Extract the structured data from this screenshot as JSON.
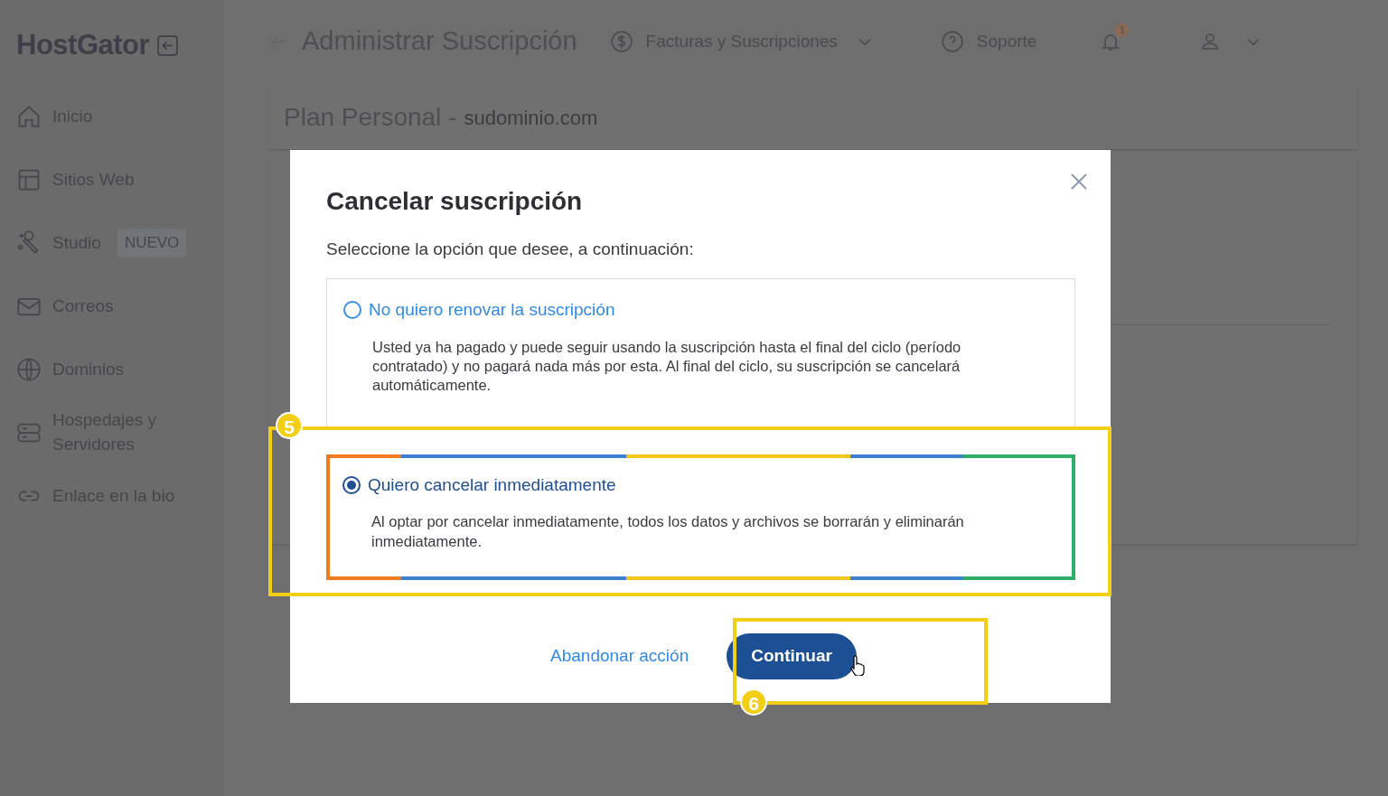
{
  "sidebar": {
    "logo": "HostGator",
    "items": [
      {
        "kind": "home",
        "label": "Inicio"
      },
      {
        "kind": "layout",
        "label": "Sitios Web"
      },
      {
        "kind": "wand",
        "label": "Studio",
        "badge": "NUEVO"
      },
      {
        "kind": "mail",
        "label": "Correos"
      },
      {
        "kind": "globe",
        "label": "Dominios"
      },
      {
        "kind": "server",
        "label": "Hospedajes y Servidores"
      },
      {
        "kind": "link",
        "label": "Enlace en la bio"
      }
    ]
  },
  "header": {
    "title": "Administrar Suscripción",
    "menu": "Facturas y Suscripciones",
    "support": "Soporte",
    "notifications": "1"
  },
  "plan": {
    "name": "Plan Personal - ",
    "domain": "sudominio.com"
  },
  "modal": {
    "title": "Cancelar suscripción",
    "subtitle": "Seleccione la opción que desee, a continuación:",
    "options": [
      {
        "label": "No quiero renovar la suscripción",
        "description": "Usted ya ha pagado y puede seguir usando la suscripción hasta el final del ciclo (período contratado) y no pagará nada más por esta. Al final del ciclo, su suscripción se cancelará automáticamente.",
        "selected": false
      },
      {
        "label": "Quiero cancelar inmediatamente",
        "description": "Al optar por cancelar inmediatamente, todos los datos y archivos se borrarán y eliminarán inmediatamente.",
        "selected": true
      }
    ],
    "cancel": "Abandonar acción",
    "continue": "Continuar"
  },
  "annotations": [
    {
      "number": "5"
    },
    {
      "number": "6"
    }
  ]
}
